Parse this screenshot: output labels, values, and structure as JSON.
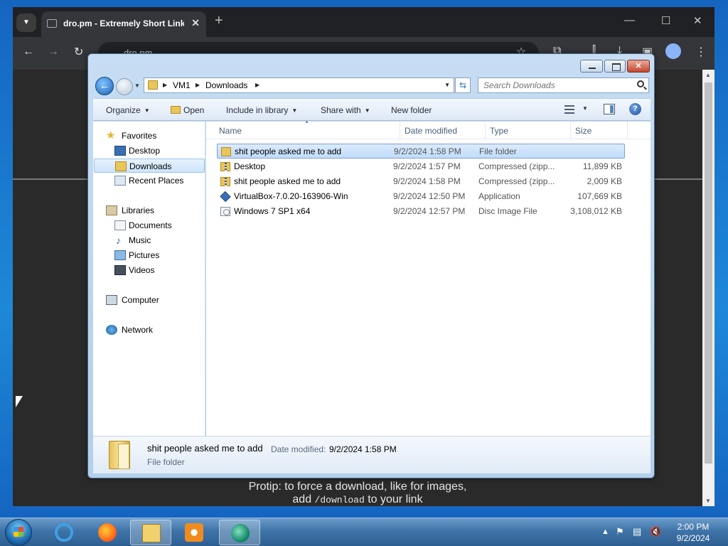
{
  "chrome": {
    "tab_title": "dro.pm - Extremely Short Links",
    "url": "dro.pm",
    "protip_line1": "Protip: to force a download, like for images,",
    "protip_line2a": "add ",
    "protip_code": "/download",
    "protip_line2b": " to your link"
  },
  "explorer": {
    "breadcrumb": [
      "VM1",
      "Downloads"
    ],
    "search_placeholder": "Search Downloads",
    "toolbar": {
      "organize": "Organize",
      "open": "Open",
      "include_in_library": "Include in library",
      "share_with": "Share with",
      "new_folder": "New folder"
    },
    "nav": {
      "favorites": "Favorites",
      "desktop": "Desktop",
      "downloads": "Downloads",
      "recent_places": "Recent Places",
      "libraries": "Libraries",
      "documents": "Documents",
      "music": "Music",
      "pictures": "Pictures",
      "videos": "Videos",
      "computer": "Computer",
      "network": "Network"
    },
    "columns": {
      "name": "Name",
      "date": "Date modified",
      "type": "Type",
      "size": "Size"
    },
    "files": [
      {
        "name": "shit people asked me to add",
        "date": "9/2/2024 1:58 PM",
        "type": "File folder",
        "size": "",
        "icon": "folder-icon"
      },
      {
        "name": "Desktop",
        "date": "9/2/2024 1:57 PM",
        "type": "Compressed (zipp...",
        "size": "11,899 KB",
        "icon": "zip-icon"
      },
      {
        "name": "shit people asked me to add",
        "date": "9/2/2024 1:58 PM",
        "type": "Compressed (zipp...",
        "size": "2,009 KB",
        "icon": "zip-icon"
      },
      {
        "name": "VirtualBox-7.0.20-163906-Win",
        "date": "9/2/2024 12:50 PM",
        "type": "Application",
        "size": "107,669 KB",
        "icon": "virtualbox-icon"
      },
      {
        "name": "Windows 7 SP1 x64",
        "date": "9/2/2024 12:57 PM",
        "type": "Disc Image File",
        "size": "3,108,012 KB",
        "icon": "disc-image-icon"
      }
    ],
    "details": {
      "name": "shit people asked me to add",
      "date_label": "Date modified:",
      "date_value": "9/2/2024 1:58 PM",
      "type": "File folder"
    }
  },
  "taskbar": {
    "time": "2:00 PM",
    "date": "9/2/2024"
  }
}
